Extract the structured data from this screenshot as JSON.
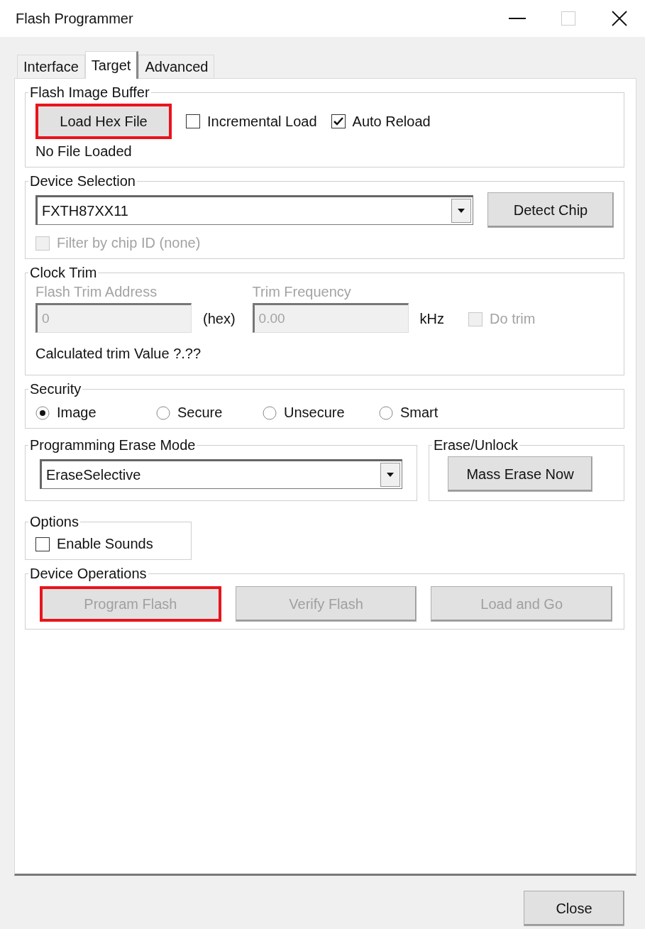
{
  "window": {
    "title": "Flash Programmer"
  },
  "tabs": [
    {
      "label": "Interface",
      "selected": false
    },
    {
      "label": "Target",
      "selected": true
    },
    {
      "label": "Advanced",
      "selected": false
    }
  ],
  "flash_image_buffer": {
    "title": "Flash Image Buffer",
    "load_button": {
      "label": "Load Hex File",
      "highlighted": true
    },
    "checkboxes": [
      {
        "label": "Incremental Load",
        "checked": false
      },
      {
        "label": "Auto Reload",
        "checked": true
      }
    ],
    "status": "No File Loaded"
  },
  "device_selection": {
    "title": "Device Selection",
    "device": "FXTH87XX11",
    "detect_button": "Detect Chip",
    "filter": {
      "label": "Filter by chip ID (none)",
      "checked": false,
      "disabled": true
    }
  },
  "clock_trim": {
    "title": "Clock Trim",
    "fields": [
      {
        "label": "Flash Trim Address",
        "value": "0",
        "unit": "(hex)",
        "disabled": true
      },
      {
        "label": "Trim Frequency",
        "value": "0.00",
        "unit": "kHz",
        "disabled": true
      }
    ],
    "do_trim": {
      "label": "Do trim",
      "checked": false,
      "disabled": true
    },
    "calculated": "Calculated trim Value ?.??"
  },
  "security": {
    "title": "Security",
    "options": [
      {
        "label": "Image",
        "selected": true
      },
      {
        "label": "Secure",
        "selected": false
      },
      {
        "label": "Unsecure",
        "selected": false
      },
      {
        "label": "Smart",
        "selected": false
      }
    ]
  },
  "erase_mode": {
    "title": "Programming Erase Mode",
    "value": "EraseSelective"
  },
  "erase_unlock": {
    "title": "Erase/Unlock",
    "button": "Mass Erase Now"
  },
  "options": {
    "title": "Options",
    "checkboxes": [
      {
        "label": "Enable Sounds",
        "checked": false
      }
    ]
  },
  "device_operations": {
    "title": "Device Operations",
    "buttons": [
      {
        "label": "Program Flash",
        "disabled": true,
        "highlighted": true
      },
      {
        "label": "Verify Flash",
        "disabled": true,
        "highlighted": false
      },
      {
        "label": "Load and Go",
        "disabled": true,
        "highlighted": false
      }
    ]
  },
  "footer": {
    "close_button": "Close"
  }
}
